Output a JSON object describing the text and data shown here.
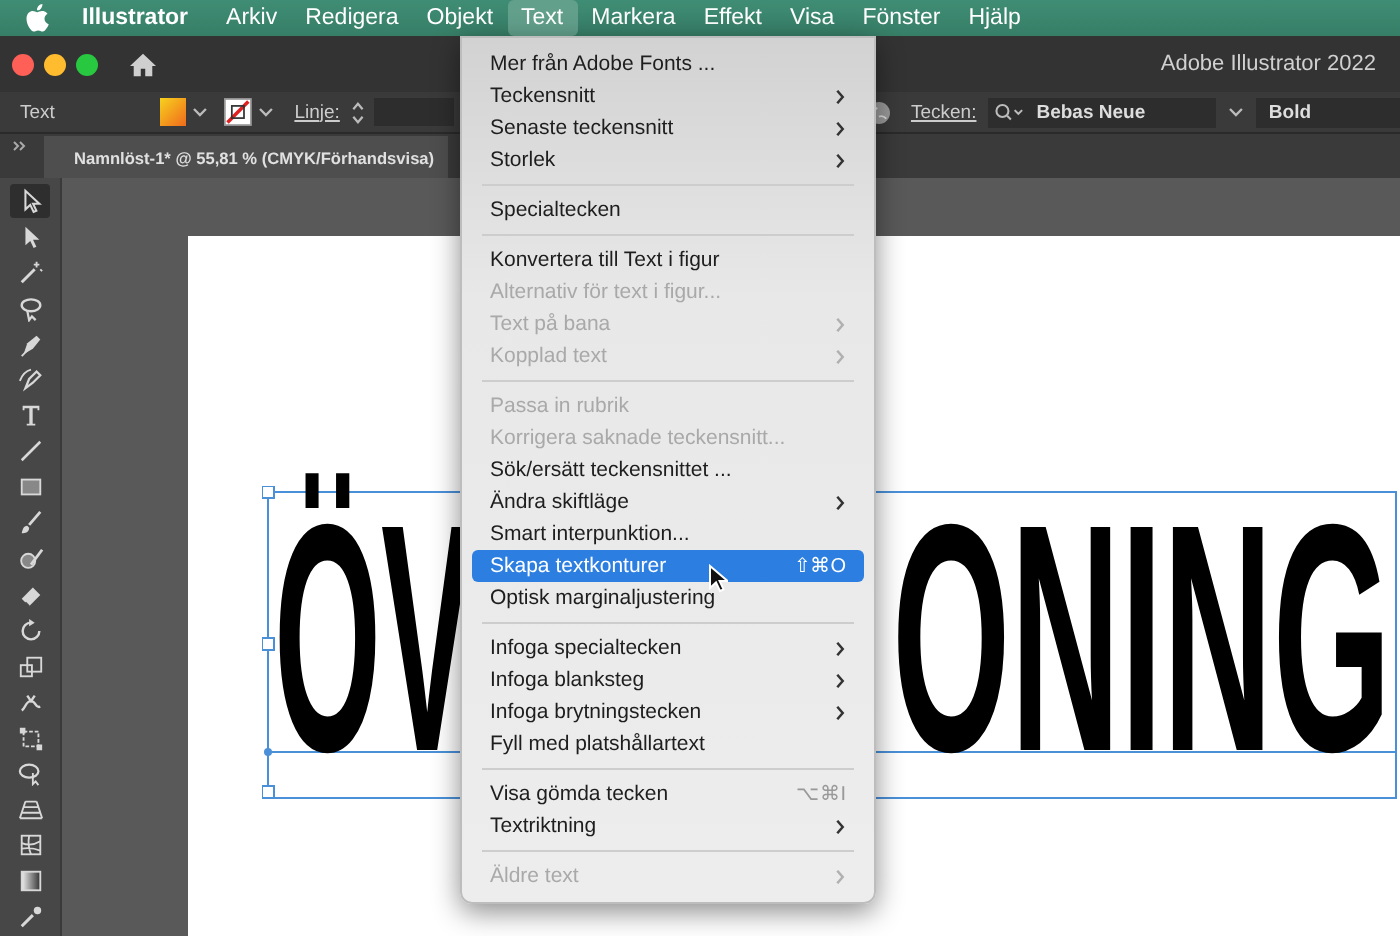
{
  "menu_bar": {
    "app_name": "Illustrator",
    "items": [
      {
        "label": "Arkiv",
        "selected": false
      },
      {
        "label": "Redigera",
        "selected": false
      },
      {
        "label": "Objekt",
        "selected": false
      },
      {
        "label": "Text",
        "selected": true
      },
      {
        "label": "Markera",
        "selected": false
      },
      {
        "label": "Effekt",
        "selected": false
      },
      {
        "label": "Visa",
        "selected": false
      },
      {
        "label": "Fönster",
        "selected": false
      },
      {
        "label": "Hjälp",
        "selected": false
      }
    ]
  },
  "window": {
    "title": "Adobe Illustrator 2022"
  },
  "control_bar": {
    "selection_label": "Text",
    "stroke_label": "Linje:",
    "character_label": "Tecken:",
    "font_family": "Bebas Neue",
    "font_style": "Bold"
  },
  "document_tab": {
    "title": "Namnlöst-1* @ 55,81 % (CMYK/Förhandsvisa)"
  },
  "toolbar": {
    "tools": [
      {
        "kind": "selection",
        "selected": true
      },
      {
        "kind": "direct-selection",
        "selected": false
      },
      {
        "kind": "magic-wand",
        "selected": false
      },
      {
        "kind": "lasso",
        "selected": false
      },
      {
        "kind": "pen",
        "selected": false
      },
      {
        "kind": "curvature",
        "selected": false
      },
      {
        "kind": "type",
        "selected": false
      },
      {
        "kind": "line",
        "selected": false
      },
      {
        "kind": "rectangle",
        "selected": false
      },
      {
        "kind": "paintbrush",
        "selected": false
      },
      {
        "kind": "shaper",
        "selected": false
      },
      {
        "kind": "eraser",
        "selected": false
      },
      {
        "kind": "rotate",
        "selected": false
      },
      {
        "kind": "scale",
        "selected": false
      },
      {
        "kind": "warp",
        "selected": false
      },
      {
        "kind": "free-transform",
        "selected": false
      },
      {
        "kind": "shape-builder",
        "selected": false
      },
      {
        "kind": "perspective",
        "selected": false
      },
      {
        "kind": "mesh",
        "selected": false
      },
      {
        "kind": "gradient",
        "selected": false
      },
      {
        "kind": "eyedropper",
        "selected": false
      }
    ]
  },
  "artboard": {
    "text_fragments": [
      "ÖV",
      "ONING"
    ]
  },
  "text_menu": {
    "items": [
      {
        "kind": "item",
        "label": "Mer från Adobe Fonts ...",
        "submenu": false,
        "disabled": false,
        "selected": false
      },
      {
        "kind": "item",
        "label": "Teckensnitt",
        "submenu": true,
        "disabled": false,
        "selected": false
      },
      {
        "kind": "item",
        "label": "Senaste teckensnitt",
        "submenu": true,
        "disabled": false,
        "selected": false
      },
      {
        "kind": "item",
        "label": "Storlek",
        "submenu": true,
        "disabled": false,
        "selected": false
      },
      {
        "kind": "separator"
      },
      {
        "kind": "item",
        "label": "Specialtecken",
        "submenu": false,
        "disabled": false,
        "selected": false
      },
      {
        "kind": "separator"
      },
      {
        "kind": "item",
        "label": "Konvertera till Text i figur",
        "submenu": false,
        "disabled": false,
        "selected": false
      },
      {
        "kind": "item",
        "label": "Alternativ för text i figur...",
        "submenu": false,
        "disabled": true,
        "selected": false
      },
      {
        "kind": "item",
        "label": "Text på bana",
        "submenu": true,
        "disabled": true,
        "selected": false
      },
      {
        "kind": "item",
        "label": "Kopplad text",
        "submenu": true,
        "disabled": true,
        "selected": false
      },
      {
        "kind": "separator"
      },
      {
        "kind": "item",
        "label": "Passa in rubrik",
        "submenu": false,
        "disabled": true,
        "selected": false
      },
      {
        "kind": "item",
        "label": "Korrigera saknade teckensnitt...",
        "submenu": false,
        "disabled": true,
        "selected": false
      },
      {
        "kind": "item",
        "label": "Sök/ersätt teckensnittet ...",
        "submenu": false,
        "disabled": false,
        "selected": false
      },
      {
        "kind": "item",
        "label": "Ändra skiftläge",
        "submenu": true,
        "disabled": false,
        "selected": false
      },
      {
        "kind": "item",
        "label": "Smart interpunktion...",
        "submenu": false,
        "disabled": false,
        "selected": false
      },
      {
        "kind": "item",
        "label": "Skapa textkonturer",
        "submenu": false,
        "disabled": false,
        "selected": true,
        "shortcut": "⇧⌘O"
      },
      {
        "kind": "item",
        "label": "Optisk marginaljustering",
        "submenu": false,
        "disabled": false,
        "selected": false
      },
      {
        "kind": "separator"
      },
      {
        "kind": "item",
        "label": "Infoga specialtecken",
        "submenu": true,
        "disabled": false,
        "selected": false
      },
      {
        "kind": "item",
        "label": "Infoga blanksteg",
        "submenu": true,
        "disabled": false,
        "selected": false
      },
      {
        "kind": "item",
        "label": "Infoga brytningstecken",
        "submenu": true,
        "disabled": false,
        "selected": false
      },
      {
        "kind": "item",
        "label": "Fyll med platshållartext",
        "submenu": false,
        "disabled": false,
        "selected": false
      },
      {
        "kind": "separator"
      },
      {
        "kind": "item",
        "label": "Visa gömda tecken",
        "submenu": false,
        "disabled": false,
        "selected": false,
        "shortcut": "⌥⌘I"
      },
      {
        "kind": "item",
        "label": "Textriktning",
        "submenu": true,
        "disabled": false,
        "selected": false
      },
      {
        "kind": "separator"
      },
      {
        "kind": "item",
        "label": "Äldre text",
        "submenu": true,
        "disabled": true,
        "selected": false
      }
    ]
  }
}
